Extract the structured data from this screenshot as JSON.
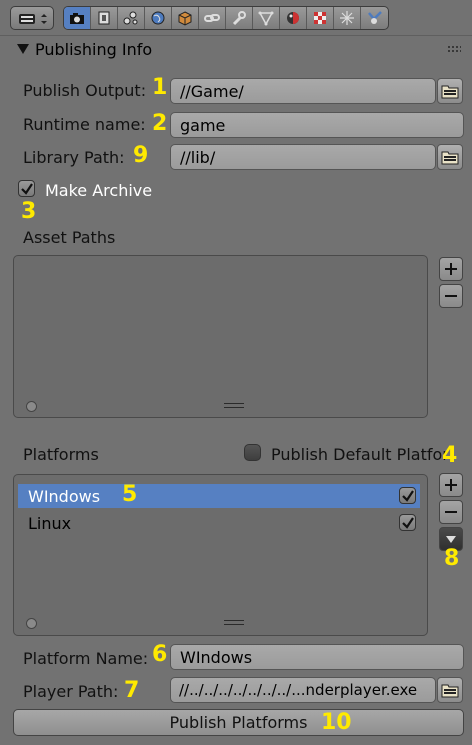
{
  "panel": {
    "title": "Publishing Info"
  },
  "toolbar": {
    "tabs": [
      "render",
      "render-layers",
      "scene",
      "world",
      "object",
      "constraints",
      "modifiers",
      "data",
      "material",
      "texture",
      "particles",
      "physics"
    ]
  },
  "fields": {
    "publish_output": {
      "label": "Publish Output:",
      "value": "//Game/"
    },
    "runtime_name": {
      "label": "Runtime name:",
      "value": "game"
    },
    "library_path": {
      "label": "Library Path:",
      "value": "//lib/"
    },
    "platform_name": {
      "label": "Platform Name:",
      "value": "WIndows"
    },
    "player_path": {
      "label": "Player Path:",
      "value": "//../../../../../../../...nderplayer.exe"
    }
  },
  "make_archive": {
    "label": "Make Archive",
    "checked": true
  },
  "asset_paths": {
    "label": "Asset Paths"
  },
  "platforms": {
    "label": "Platforms",
    "publish_default_label": "Publish Default Platform",
    "items": [
      {
        "name": "WIndows",
        "enabled": true,
        "selected": true
      },
      {
        "name": "Linux",
        "enabled": true,
        "selected": false
      }
    ]
  },
  "publish_button": {
    "label": "Publish Platforms"
  },
  "annotations": {
    "a1": "1",
    "a2": "2",
    "a3": "3",
    "a4": "4",
    "a5": "5",
    "a6": "6",
    "a7": "7",
    "a8": "8",
    "a9": "9",
    "a10": "10"
  },
  "colors": {
    "accent": "#5680c2",
    "annotation": "#ffea00",
    "background": "#727272"
  }
}
